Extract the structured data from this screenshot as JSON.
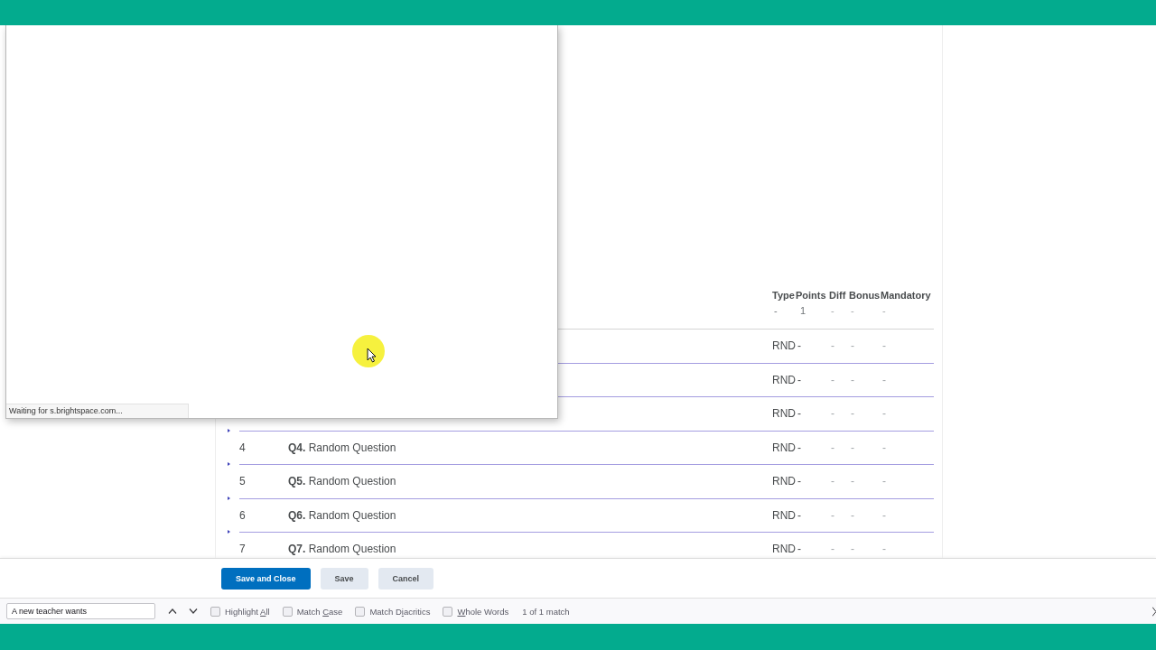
{
  "table": {
    "columns": [
      "Type",
      "Points",
      "Diff",
      "Bonus",
      "Mandatory"
    ],
    "summary_row": [
      "-",
      "1",
      "-",
      "-",
      "-"
    ],
    "rows": [
      {
        "values": [
          "RND",
          "-",
          "-",
          "-",
          "-"
        ]
      },
      {
        "values": [
          "RND",
          "-",
          "-",
          "-",
          "-"
        ]
      },
      {
        "values": [
          "RND",
          "-",
          "-",
          "-",
          "-"
        ]
      },
      {
        "number": "4",
        "question": "**Q4.** Random Question",
        "values": [
          "RND",
          "-",
          "-",
          "-",
          "-"
        ]
      },
      {
        "number": "5",
        "question": "**Q5.** Random Question",
        "values": [
          "RND",
          "-",
          "-",
          "-",
          "-"
        ]
      },
      {
        "number": "6",
        "question": "**Q6.** Random Question",
        "values": [
          "RND",
          "-",
          "-",
          "-",
          "-"
        ]
      },
      {
        "number": "7",
        "question": "**Q7.** Random Question",
        "values": [
          "RND",
          "-",
          "-",
          "-",
          "-"
        ]
      }
    ]
  },
  "popup": {
    "status": "Waiting for s.brightspace.com..."
  },
  "actions": {
    "buttons": [
      {
        "label": "Save and Close",
        "kind": "primary"
      },
      {
        "label": "Save",
        "kind": "secondary"
      },
      {
        "label": "Cancel",
        "kind": "secondary"
      }
    ]
  },
  "find_bar": {
    "query": "A new teacher wants",
    "options": [
      {
        "before": "Highlight ",
        "key": "A",
        "after": "ll",
        "checked": false
      },
      {
        "before": "Match ",
        "key": "C",
        "after": "ase",
        "checked": false
      },
      {
        "before": "Match D",
        "key": "i",
        "after": "acritics",
        "checked": false
      },
      {
        "key": "W",
        "after": "hole Words",
        "checked": false
      }
    ],
    "result": "1 of 1 match"
  }
}
